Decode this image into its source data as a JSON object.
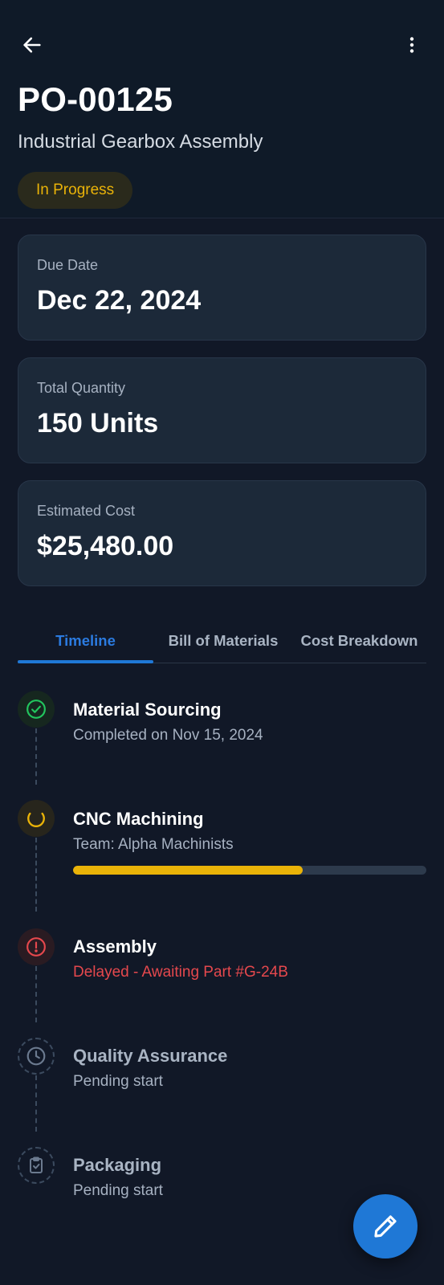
{
  "header": {
    "order_id": "PO-00125",
    "product_name": "Industrial Gearbox Assembly",
    "status": "In Progress",
    "back_icon": "arrow-left-icon",
    "menu_icon": "more-vertical-icon"
  },
  "summary": {
    "due_date": {
      "label": "Due Date",
      "value": "Dec 22, 2024"
    },
    "quantity": {
      "label": "Total Quantity",
      "value": "150 Units"
    },
    "cost": {
      "label": "Estimated Cost",
      "value": "$25,480.00"
    }
  },
  "tabs": [
    {
      "label": "Timeline",
      "active": true
    },
    {
      "label": "Bill of Materials",
      "active": false
    },
    {
      "label": "Cost Breakdown",
      "active": false
    }
  ],
  "timeline": [
    {
      "title": "Material Sourcing",
      "subtitle": "Completed on Nov 15, 2024",
      "state": "completed",
      "icon": "check-circle-icon"
    },
    {
      "title": "CNC Machining",
      "subtitle": "Team: Alpha Machinists",
      "state": "in-progress",
      "icon": "spinner-icon",
      "progress": 0.65
    },
    {
      "title": "Assembly",
      "subtitle": "Delayed - Awaiting Part #G-24B",
      "state": "delayed",
      "icon": "alert-circle-icon"
    },
    {
      "title": "Quality Assurance",
      "subtitle": "Pending start",
      "state": "pending",
      "icon": "clock-icon"
    },
    {
      "title": "Packaging",
      "subtitle": "Pending start",
      "state": "pending",
      "icon": "clipboard-check-icon"
    }
  ],
  "fab": {
    "icon": "pencil-icon"
  },
  "colors": {
    "background": "#111827",
    "card": "#1c2939",
    "accent": "#1f78d6",
    "success": "#22c55e",
    "warning": "#eab308",
    "danger": "#e5484d"
  }
}
